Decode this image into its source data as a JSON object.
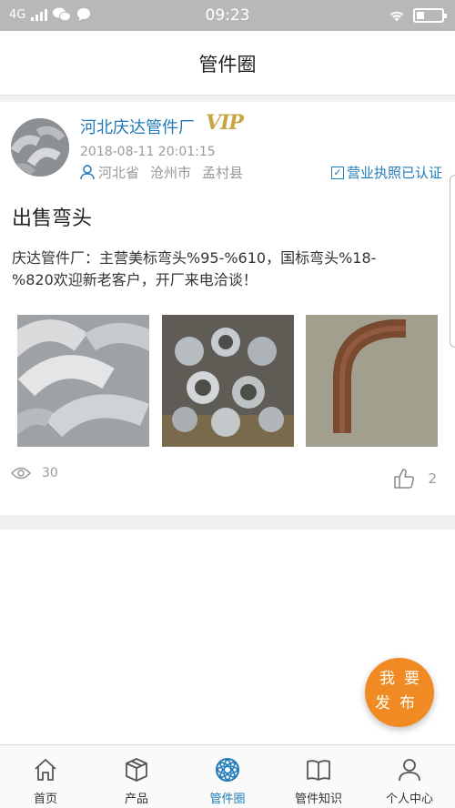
{
  "status_bar": {
    "network": "4G",
    "time": "09:23"
  },
  "header": {
    "title": "管件圈"
  },
  "post": {
    "company": "河北庆达管件厂",
    "vip_badge": "VIP",
    "time": "2018-08-11 20:01:15",
    "location": {
      "province": "河北省",
      "city": "沧州市",
      "county": "孟村县"
    },
    "verified_label": "营业执照已认证",
    "title": "出售弯头",
    "content": "庆达管件厂：主营美标弯头%95-%610，国标弯头%18-%820欢迎新老客户，开厂来电洽谈！",
    "views": "30",
    "likes": "2"
  },
  "fab": {
    "label": "我要发布"
  },
  "tab_bar": {
    "items": [
      {
        "label": "首页",
        "icon": "home-icon"
      },
      {
        "label": "产品",
        "icon": "box-icon"
      },
      {
        "label": "管件圈",
        "icon": "circle-hub-icon"
      },
      {
        "label": "管件知识",
        "icon": "book-icon"
      },
      {
        "label": "个人中心",
        "icon": "user-icon"
      }
    ],
    "active_index": 2
  },
  "colors": {
    "accent": "#1f7bb8",
    "fab": "#f08a22",
    "status_bar": "#b8b8b8"
  }
}
